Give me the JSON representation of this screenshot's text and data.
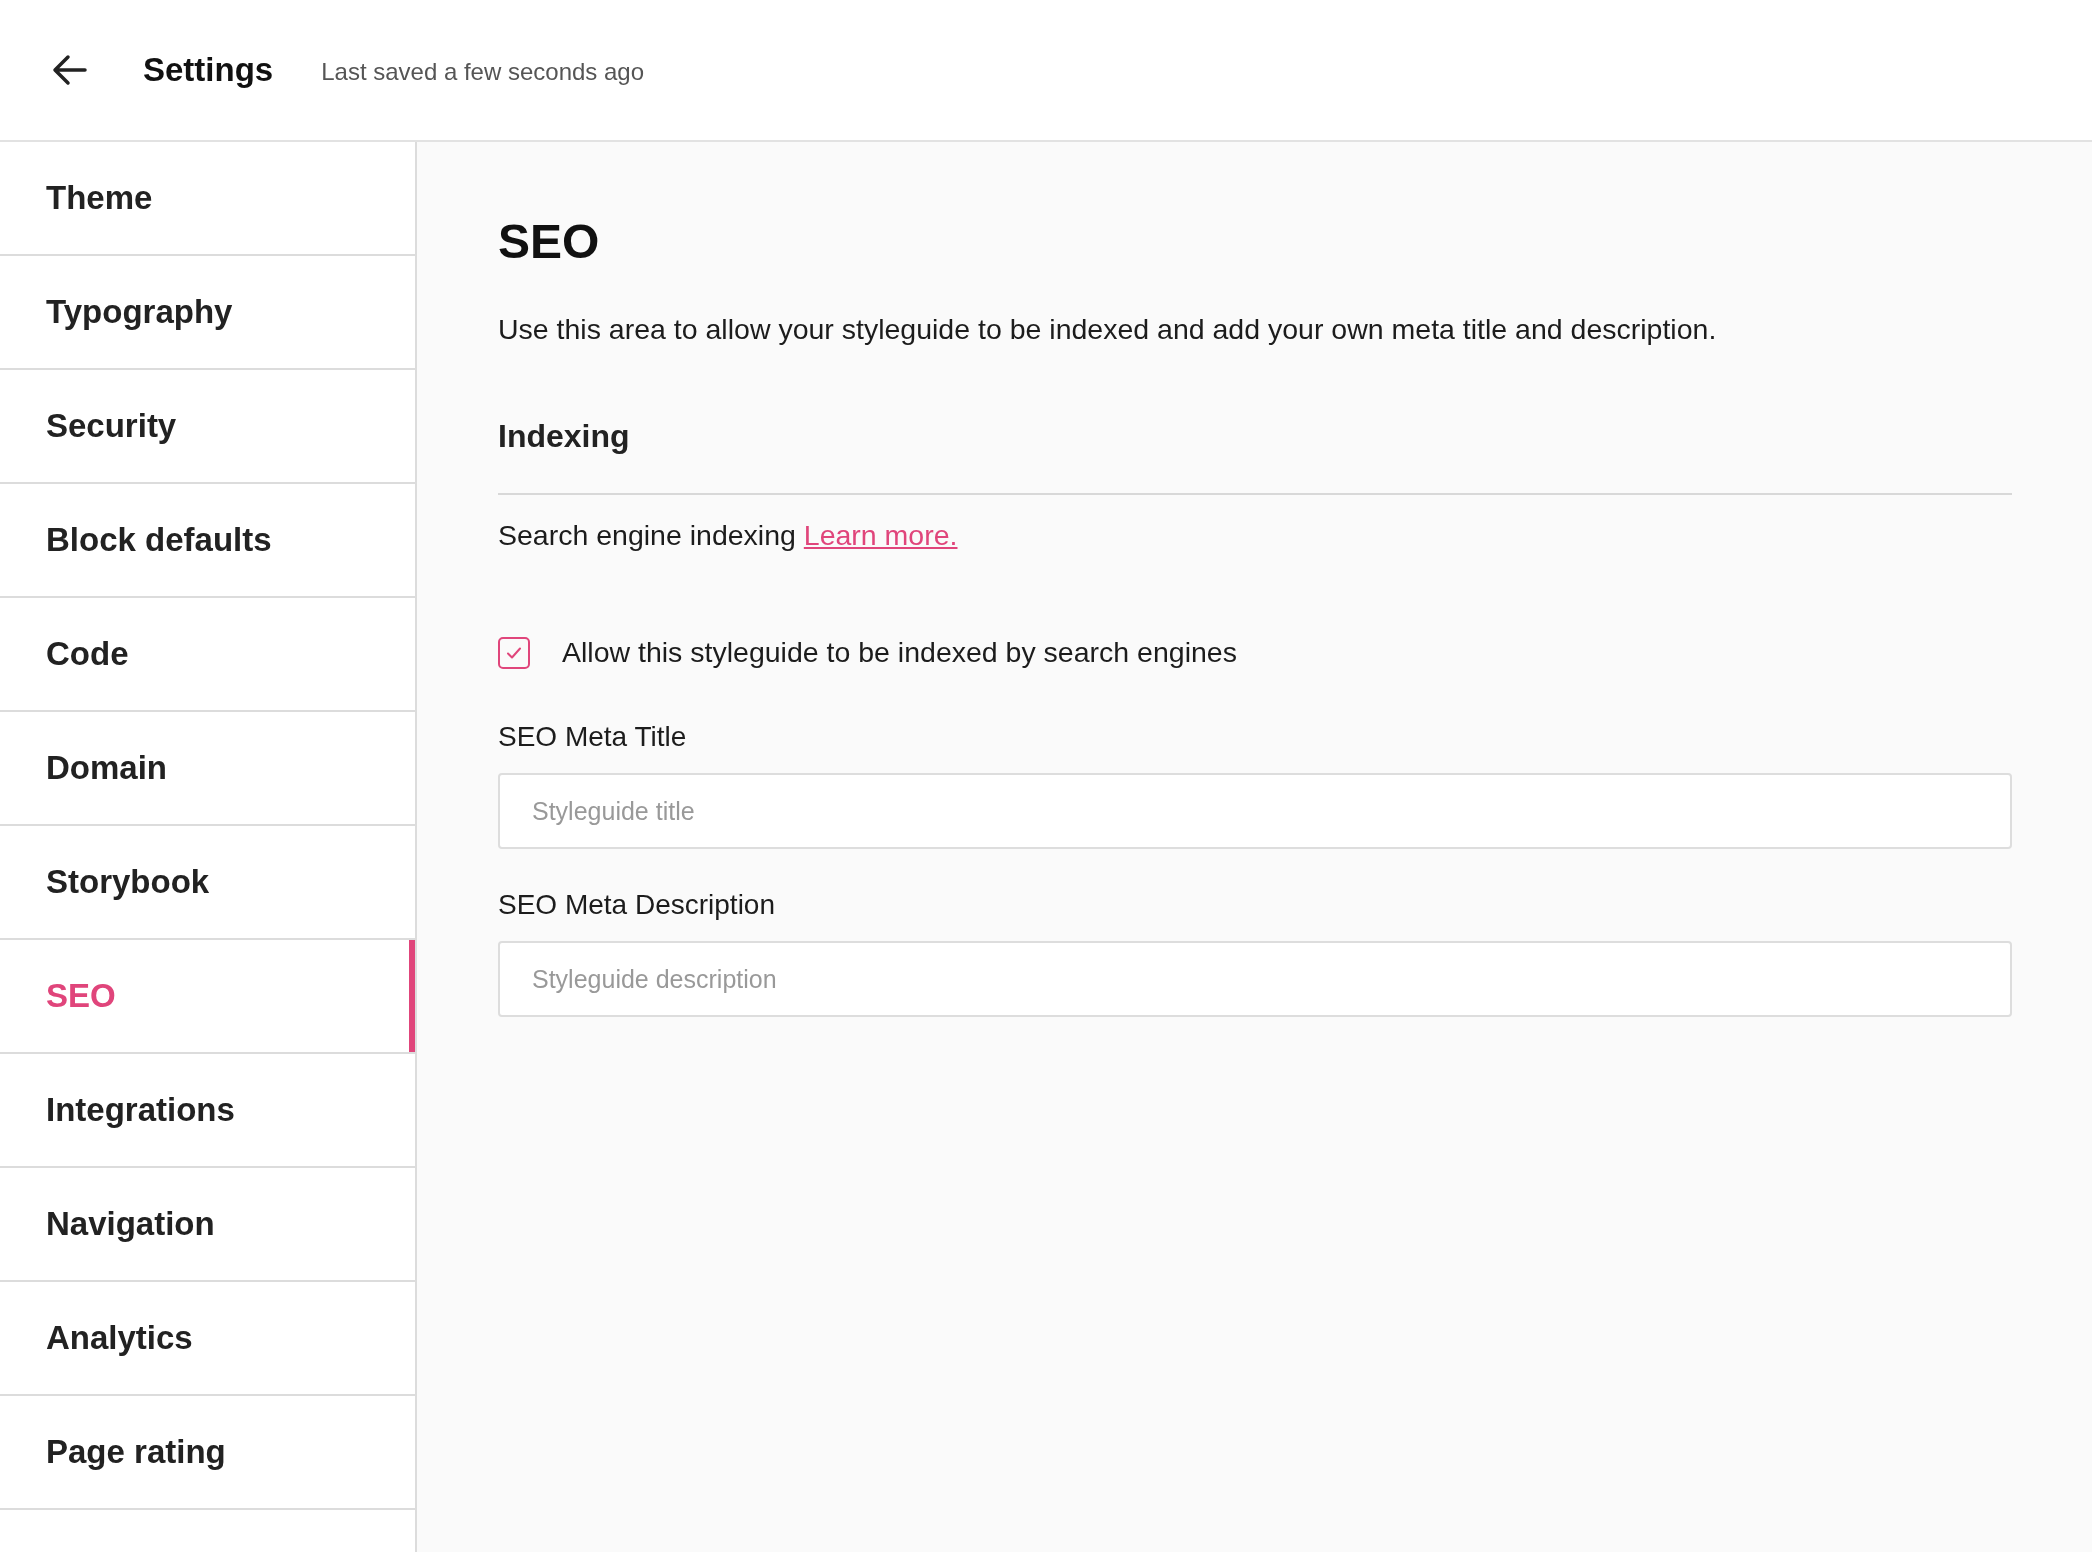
{
  "header": {
    "title": "Settings",
    "status": "Last saved a few seconds ago"
  },
  "sidebar": {
    "items": [
      {
        "label": "Theme",
        "selected": false
      },
      {
        "label": "Typography",
        "selected": false
      },
      {
        "label": "Security",
        "selected": false
      },
      {
        "label": "Block defaults",
        "selected": false
      },
      {
        "label": "Code",
        "selected": false
      },
      {
        "label": "Domain",
        "selected": false
      },
      {
        "label": "Storybook",
        "selected": false
      },
      {
        "label": "SEO",
        "selected": true
      },
      {
        "label": "Integrations",
        "selected": false
      },
      {
        "label": "Navigation",
        "selected": false
      },
      {
        "label": "Analytics",
        "selected": false
      },
      {
        "label": "Page rating",
        "selected": false
      }
    ]
  },
  "content": {
    "title": "SEO",
    "intro": "Use this area to allow your styleguide to be indexed and add your own meta title and description.",
    "section": "Indexing",
    "indexing_text": "Search engine indexing",
    "link": "Learn more.",
    "checkbox": {
      "label": "Allow this styleguide to be indexed by search engines",
      "checked": true
    },
    "fields": [
      {
        "label": "SEO Meta Title",
        "placeholder": "Styleguide title"
      },
      {
        "label": "SEO Meta Description",
        "placeholder": "Styleguide description"
      }
    ]
  }
}
